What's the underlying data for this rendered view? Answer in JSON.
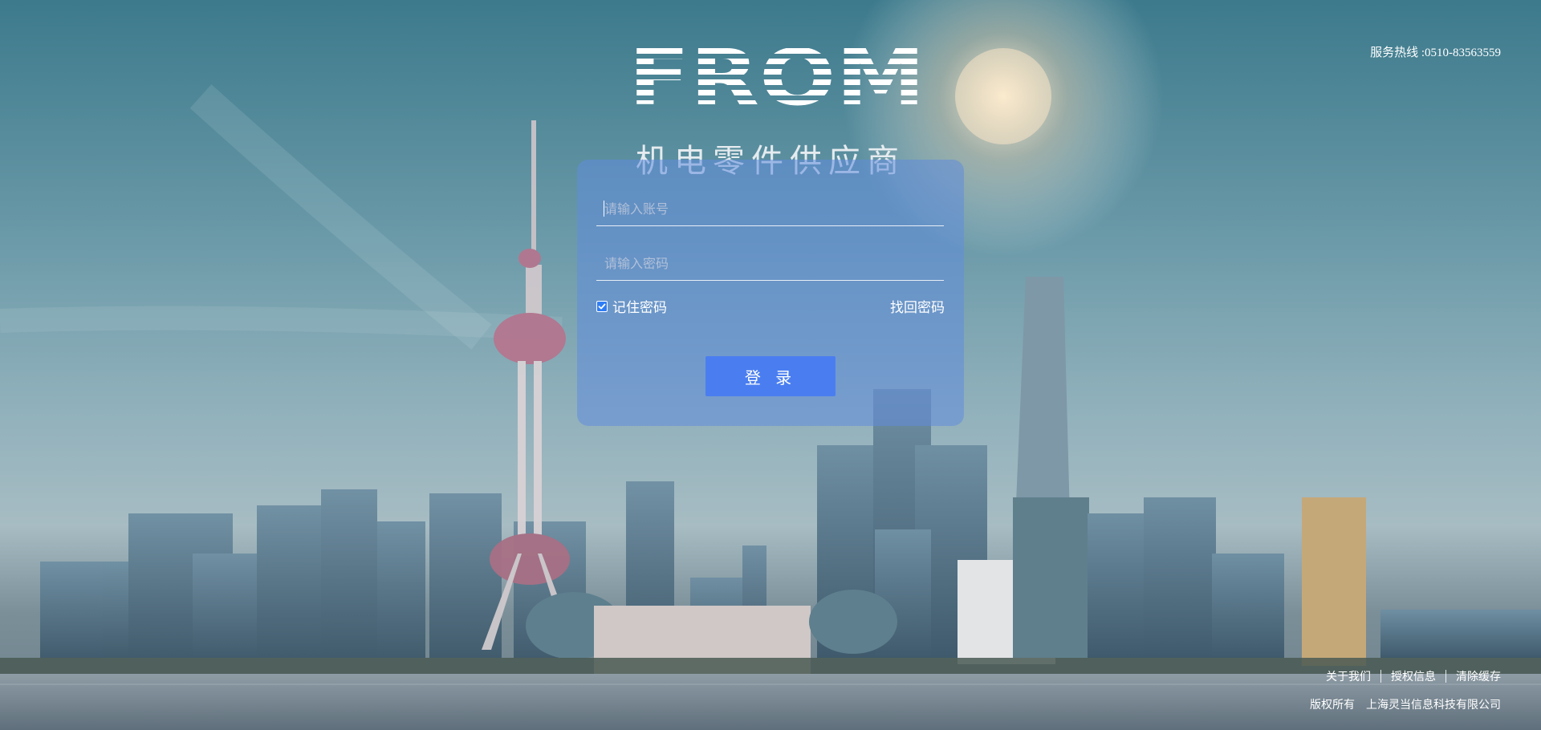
{
  "header": {
    "hotline": "服务热线 :0510-83563559",
    "logo_text": "FROM",
    "tagline": "机电零件供应商"
  },
  "login": {
    "username_placeholder": "请输入账号",
    "password_placeholder": "请输入密码",
    "remember_label": "记住密码",
    "remember_checked": true,
    "forgot_label": "找回密码",
    "submit_label": "登 录"
  },
  "footer": {
    "links": [
      "关于我们",
      "授权信息",
      "清除缓存"
    ],
    "copyright_label": "版权所有",
    "company": "上海灵当信息科技有限公司"
  },
  "colors": {
    "card": "#608cdc",
    "button": "#4a7ef0",
    "checkbox": "#2f7df6"
  }
}
